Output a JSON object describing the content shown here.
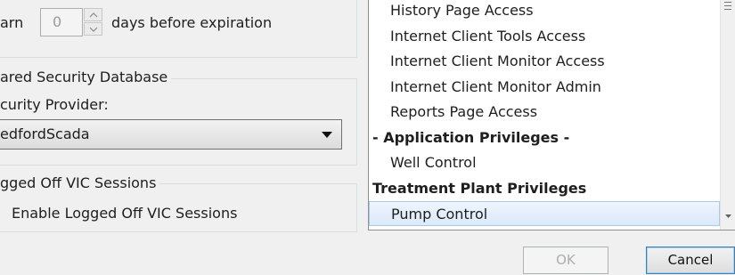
{
  "warn": {
    "label_prefix": "arn",
    "value": "0",
    "label_suffix": "days before expiration"
  },
  "shared_security": {
    "legend": "ared Security Database",
    "provider_label": "curity Provider:",
    "provider_value": "edfordScada"
  },
  "logged_off": {
    "legend": "gged Off VIC Sessions",
    "checkbox_label": "Enable Logged Off VIC Sessions"
  },
  "privileges": {
    "items": [
      {
        "label": "History Page Access",
        "header": false,
        "selected": false
      },
      {
        "label": "Internet Client Tools Access",
        "header": false,
        "selected": false
      },
      {
        "label": "Internet Client Monitor Access",
        "header": false,
        "selected": false
      },
      {
        "label": "Internet Client Monitor Admin",
        "header": false,
        "selected": false
      },
      {
        "label": "Reports Page Access",
        "header": false,
        "selected": false
      },
      {
        "label": "- Application Privileges -",
        "header": true,
        "selected": false
      },
      {
        "label": "Well Control",
        "header": false,
        "selected": false
      },
      {
        "label": "Treatment Plant Privileges",
        "header": true,
        "selected": false
      },
      {
        "label": "Pump Control",
        "header": false,
        "selected": true
      }
    ]
  },
  "buttons": {
    "ok": "OK",
    "cancel": "Cancel"
  },
  "icons": {
    "spin_up": "chevron-up-icon",
    "spin_down": "chevron-down-icon",
    "combo": "dropdown-arrow-icon"
  }
}
